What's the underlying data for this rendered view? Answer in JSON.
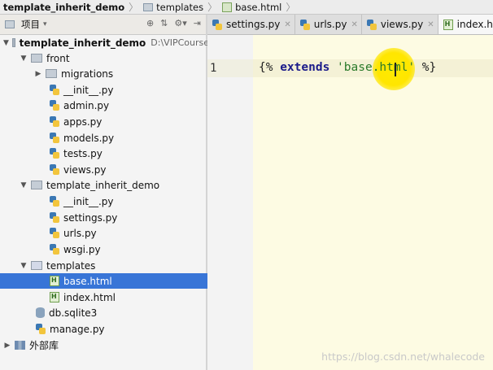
{
  "breadcrumb": [
    "template_inherit_demo",
    "templates",
    "base.html"
  ],
  "project_panel": {
    "title": "项目"
  },
  "tree": {
    "root_label": "template_inherit_demo",
    "root_path": "D:\\VIPCourse",
    "front": "front",
    "migrations": "migrations",
    "front_files": [
      "__init__.py",
      "admin.py",
      "apps.py",
      "models.py",
      "tests.py",
      "views.py"
    ],
    "pkg": "template_inherit_demo",
    "pkg_files": [
      "__init__.py",
      "settings.py",
      "urls.py",
      "wsgi.py"
    ],
    "templates": "templates",
    "template_files": [
      "base.html",
      "index.html"
    ],
    "db": "db.sqlite3",
    "manage": "manage.py",
    "external": "外部库"
  },
  "tabs": [
    "settings.py",
    "urls.py",
    "views.py",
    "index.htm"
  ],
  "editor": {
    "line_number": "1",
    "code_open": "{% ",
    "code_kw": "extends",
    "code_str": "'base.html'",
    "code_close": " %}"
  },
  "watermark": "https://blog.csdn.net/whalecode"
}
